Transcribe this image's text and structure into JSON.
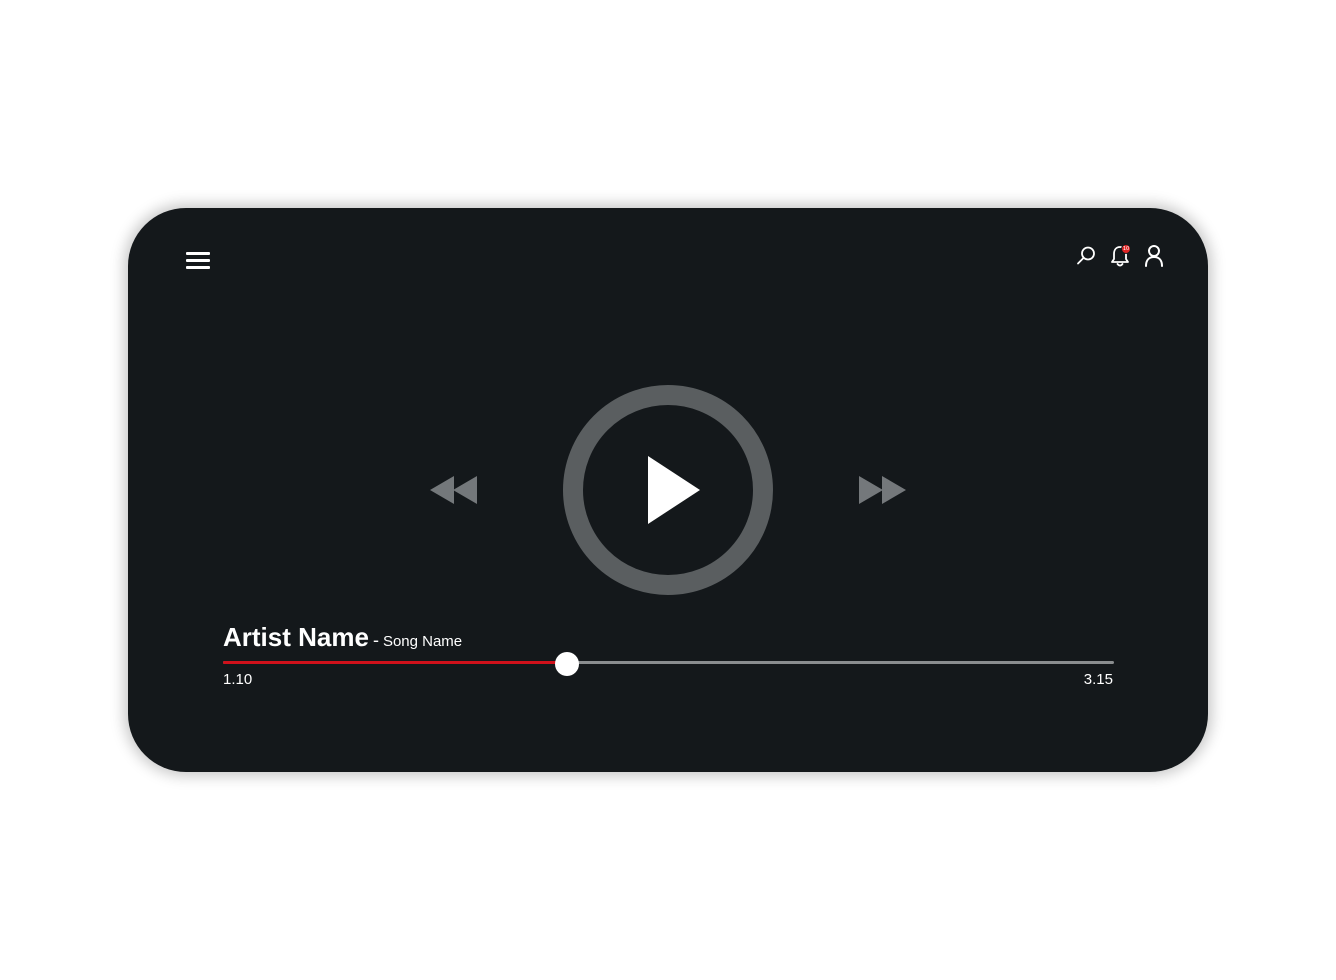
{
  "header": {
    "menu_icon": "hamburger-menu-icon",
    "search_icon": "search-icon",
    "notification_icon": "bell-icon",
    "notification_count": "10",
    "notification_badge_color": "#e02525",
    "profile_icon": "user-icon"
  },
  "controls": {
    "rewind_icon": "rewind-icon",
    "play_icon": "play-icon",
    "forward_icon": "fast-forward-icon"
  },
  "track": {
    "artist": "Artist Name",
    "separator": "-",
    "song": "Song Name"
  },
  "progress": {
    "current_time": "1.10",
    "total_time": "3.15",
    "fraction": 0.386,
    "fill_color": "#d0111b"
  },
  "colors": {
    "background": "#14181b",
    "ring": "#5a5e60",
    "secondary_controls": "#74787b"
  }
}
